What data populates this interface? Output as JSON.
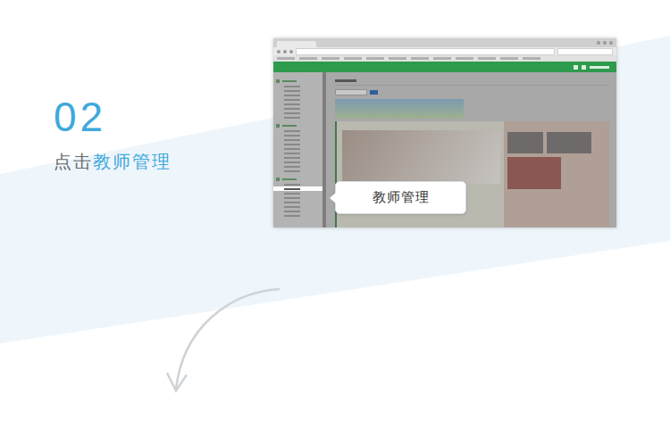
{
  "step": {
    "number": "02",
    "prefix": "点击",
    "highlight": "教师管理"
  },
  "tooltip": {
    "label": "教师管理"
  },
  "screenshot": {
    "sidebar": {
      "groups": [
        {
          "items": [
            {
              "selected": false
            },
            {
              "selected": false
            },
            {
              "selected": false
            },
            {
              "selected": false
            },
            {
              "selected": false
            },
            {
              "selected": false
            },
            {
              "selected": false
            },
            {
              "selected": false
            }
          ]
        },
        {
          "items": [
            {
              "selected": false
            },
            {
              "selected": false
            },
            {
              "selected": false
            },
            {
              "selected": false
            },
            {
              "selected": false
            },
            {
              "selected": false
            },
            {
              "selected": false
            },
            {
              "selected": false
            },
            {
              "selected": false
            },
            {
              "selected": false
            }
          ]
        },
        {
          "items": [
            {
              "selected": false
            },
            {
              "selected": true
            },
            {
              "selected": false
            },
            {
              "selected": false
            },
            {
              "selected": false
            },
            {
              "selected": false
            },
            {
              "selected": false
            },
            {
              "selected": false
            }
          ]
        }
      ]
    }
  }
}
